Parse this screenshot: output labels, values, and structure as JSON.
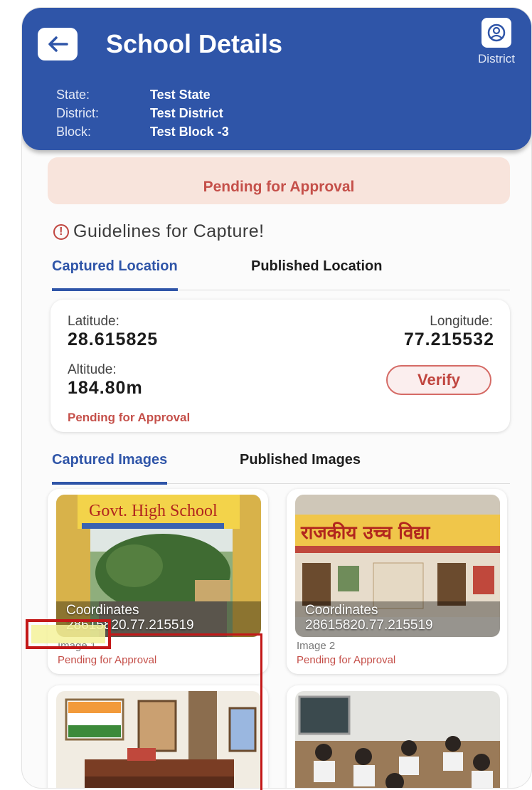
{
  "header": {
    "title": "School Details",
    "district_label": "District",
    "state_label": "State:",
    "state_value": "Test State",
    "district_field_label": "District:",
    "district_value": "Test District",
    "block_label": "Block:",
    "block_value": "Test Block -3"
  },
  "status_banner": "Pending for Approval",
  "guidelines": "Guidelines for Capture!",
  "location_tabs": [
    {
      "label": "Captured Location",
      "active": true
    },
    {
      "label": "Published Location",
      "active": false
    }
  ],
  "location": {
    "latitude_label": "Latitude:",
    "latitude_value": "28.615825",
    "longitude_label": "Longitude:",
    "longitude_value": "77.215532",
    "altitude_label": "Altitude:",
    "altitude_value": "184.80m",
    "verify_label": "Verify",
    "status": "Pending for Approval"
  },
  "image_tabs": [
    {
      "label": "Captured Images",
      "active": true
    },
    {
      "label": "Published Images",
      "active": false
    }
  ],
  "images": [
    {
      "name": "Image 1",
      "coord_label": "Coordinates",
      "coord_value": "28615820.77.215519",
      "status": "Pending for Approval",
      "sign_text": "Govt. High School"
    },
    {
      "name": "Image 2",
      "coord_label": "Coordinates",
      "coord_value": "28615820.77.215519",
      "status": "Pending for Approval",
      "sign_text": "राजकीय उच्च विद्या"
    }
  ],
  "colors": {
    "primary": "#2f55a8",
    "pending": "#c5504a",
    "banner_bg": "#f8e4dc",
    "highlight": "#c31818"
  }
}
